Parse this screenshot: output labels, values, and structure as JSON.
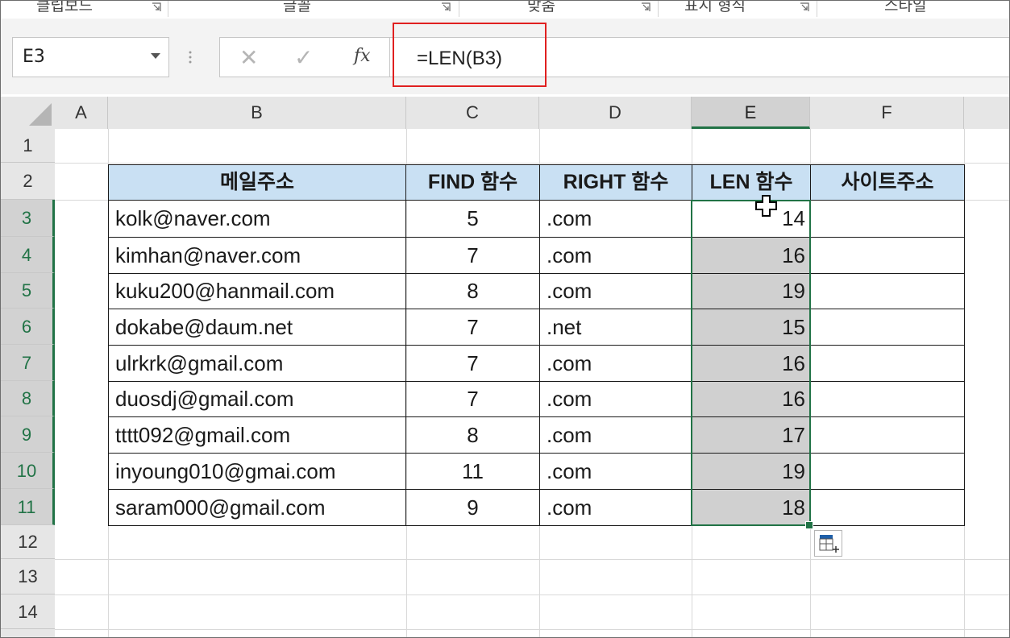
{
  "ribbon": {
    "groups": [
      "클립보드",
      "글꼴",
      "맞춤",
      "표시 형식",
      "스타일"
    ]
  },
  "formula_bar": {
    "name_box": "E3",
    "cancel_glyph": "✕",
    "enter_glyph": "✓",
    "fx_label": "fx",
    "formula": "=LEN(B3)"
  },
  "columns": [
    "A",
    "B",
    "C",
    "D",
    "E",
    "F"
  ],
  "rows": [
    "1",
    "2",
    "3",
    "4",
    "5",
    "6",
    "7",
    "8",
    "9",
    "10",
    "11",
    "12",
    "13",
    "14"
  ],
  "table": {
    "headers": [
      "메일주소",
      "FIND 함수",
      "RIGHT 함수",
      "LEN 함수",
      "사이트주소"
    ],
    "rows": [
      {
        "email": "kolk@naver.com",
        "find": "5",
        "right": ".com",
        "len": "14",
        "site": ""
      },
      {
        "email": "kimhan@naver.com",
        "find": "7",
        "right": ".com",
        "len": "16",
        "site": ""
      },
      {
        "email": "kuku200@hanmail.com",
        "find": "8",
        "right": ".com",
        "len": "19",
        "site": ""
      },
      {
        "email": "dokabe@daum.net",
        "find": "7",
        "right": ".net",
        "len": "15",
        "site": ""
      },
      {
        "email": "ulrkrk@gmail.com",
        "find": "7",
        "right": ".com",
        "len": "16",
        "site": ""
      },
      {
        "email": "duosdj@gmail.com",
        "find": "7",
        "right": ".com",
        "len": "16",
        "site": ""
      },
      {
        "email": "tttt092@gmail.com",
        "find": "8",
        "right": ".com",
        "len": "17",
        "site": ""
      },
      {
        "email": "inyoung010@gmai.com",
        "find": "11",
        "right": ".com",
        "len": "19",
        "site": ""
      },
      {
        "email": "saram000@gmail.com",
        "find": "9",
        "right": ".com",
        "len": "18",
        "site": ""
      }
    ]
  },
  "selection": {
    "active_cell": "E3",
    "range": "E3:E11"
  },
  "colors": {
    "excel_green": "#217346",
    "header_fill": "#c9e0f3",
    "highlight_red": "#e02020",
    "selection_fill": "#d0d0d0"
  }
}
